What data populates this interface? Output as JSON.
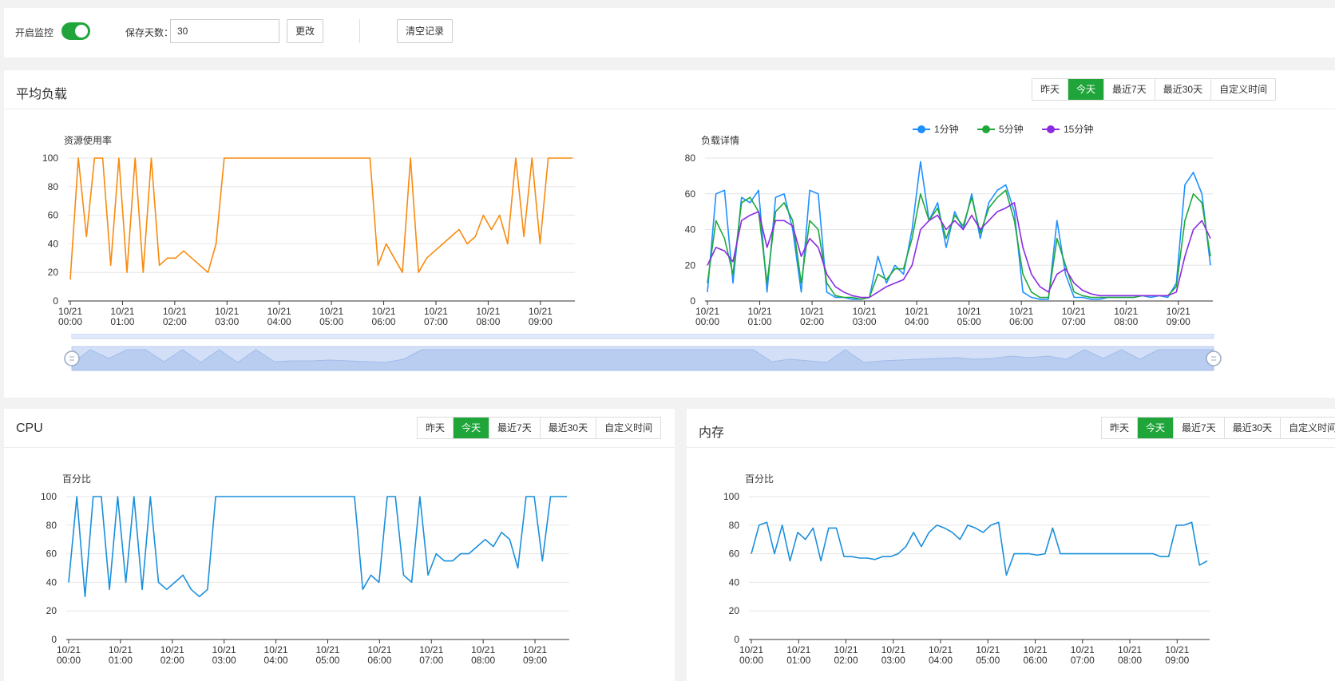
{
  "toolbar": {
    "monitor_label": "开启监控",
    "monitor_enabled": true,
    "days_label": "保存天数：",
    "days_value": "30",
    "change_button": "更改",
    "clear_button": "清空记录"
  },
  "range_options": [
    "昨天",
    "今天",
    "最近7天",
    "最近30天",
    "自定义时间"
  ],
  "active_range": "今天",
  "colors": {
    "accent": "#20a53a",
    "orange": "#f98a0e",
    "blue": "#1e90ff",
    "green": "#1fa83a",
    "purple": "#8b2be2",
    "cpu_blue": "#1a8fdc"
  },
  "x_ticks": [
    "10/21\n00:00",
    "10/21\n01:00",
    "10/21\n02:00",
    "10/21\n03:00",
    "10/21\n04:00",
    "10/21\n05:00",
    "10/21\n06:00",
    "10/21\n07:00",
    "10/21\n08:00",
    "10/21\n09:00"
  ],
  "load_panel": {
    "title": "平均负载"
  },
  "cpu_panel": {
    "title": "CPU"
  },
  "mem_panel": {
    "title": "内存"
  },
  "chart_data": [
    {
      "type": "line",
      "ylabel": "资源使用率",
      "ylim": [
        0,
        100
      ],
      "yticks": [
        0,
        20,
        40,
        60,
        80,
        100
      ],
      "x": [
        "00:00",
        "00:15",
        "00:30",
        "00:45",
        "01:00",
        "01:15",
        "01:30",
        "01:45",
        "02:00",
        "02:15",
        "02:30",
        "02:45",
        "03:00",
        "03:15",
        "03:30",
        "03:45",
        "04:00",
        "04:15",
        "04:30",
        "04:45",
        "05:00",
        "05:15",
        "05:30",
        "05:45",
        "06:00",
        "06:15",
        "06:30",
        "06:45",
        "07:00",
        "07:15",
        "07:30",
        "07:45",
        "08:00",
        "08:15",
        "08:30",
        "08:45",
        "09:00",
        "09:15",
        "09:20"
      ],
      "series": [
        {
          "color": "orange",
          "values": [
            15,
            100,
            45,
            100,
            100,
            25,
            100,
            20,
            100,
            20,
            100,
            25,
            30,
            30,
            35,
            30,
            25,
            20,
            40,
            100,
            100,
            100,
            100,
            100,
            100,
            100,
            100,
            100,
            100,
            100,
            100,
            100,
            100,
            100,
            100,
            100,
            100,
            100,
            25,
            40,
            30,
            20,
            100,
            20,
            30,
            35,
            40,
            45,
            50,
            40,
            45,
            60,
            50,
            60,
            40,
            100,
            45,
            100,
            40,
            100,
            100,
            100,
            100
          ]
        }
      ]
    },
    {
      "type": "line",
      "ylabel": "负载详情",
      "ylim": [
        0,
        80
      ],
      "yticks": [
        0,
        20,
        40,
        60,
        80
      ],
      "legend_position": "top",
      "series": [
        {
          "name": "1分钟",
          "color": "blue",
          "values": [
            5,
            60,
            62,
            10,
            58,
            55,
            62,
            5,
            58,
            60,
            40,
            5,
            62,
            60,
            5,
            2,
            2,
            1,
            1,
            2,
            25,
            10,
            20,
            15,
            40,
            78,
            45,
            55,
            30,
            50,
            40,
            60,
            35,
            55,
            62,
            65,
            50,
            5,
            2,
            1,
            1,
            45,
            15,
            2,
            2,
            1,
            1,
            2,
            2,
            2,
            2,
            3,
            2,
            3,
            2,
            10,
            65,
            72,
            60,
            20
          ]
        },
        {
          "name": "5分钟",
          "color": "green",
          "values": [
            10,
            45,
            35,
            15,
            55,
            58,
            50,
            10,
            50,
            55,
            45,
            10,
            45,
            40,
            10,
            3,
            2,
            2,
            1,
            2,
            15,
            12,
            18,
            18,
            35,
            60,
            45,
            52,
            35,
            48,
            42,
            58,
            38,
            52,
            58,
            62,
            45,
            15,
            5,
            2,
            2,
            35,
            20,
            5,
            3,
            2,
            2,
            2,
            2,
            2,
            2,
            3,
            3,
            3,
            3,
            8,
            45,
            60,
            55,
            25
          ]
        },
        {
          "name": "15分钟",
          "color": "purple",
          "values": [
            20,
            30,
            28,
            22,
            45,
            48,
            50,
            30,
            45,
            45,
            42,
            25,
            35,
            30,
            15,
            8,
            5,
            3,
            2,
            2,
            5,
            8,
            10,
            12,
            20,
            40,
            45,
            48,
            40,
            45,
            40,
            48,
            40,
            45,
            50,
            52,
            55,
            30,
            15,
            8,
            5,
            15,
            18,
            10,
            6,
            4,
            3,
            3,
            3,
            3,
            3,
            3,
            3,
            3,
            3,
            5,
            25,
            40,
            45,
            35
          ]
        }
      ]
    },
    {
      "type": "line",
      "ylabel": "百分比",
      "ylim": [
        0,
        100
      ],
      "yticks": [
        0,
        20,
        40,
        60,
        80,
        100
      ],
      "series": [
        {
          "color": "cpu_blue",
          "values": [
            40,
            100,
            30,
            100,
            100,
            35,
            100,
            40,
            100,
            35,
            100,
            40,
            35,
            40,
            45,
            35,
            30,
            35,
            100,
            100,
            100,
            100,
            100,
            100,
            100,
            100,
            100,
            100,
            100,
            100,
            100,
            100,
            100,
            100,
            100,
            100,
            35,
            45,
            40,
            100,
            100,
            45,
            40,
            100,
            45,
            60,
            55,
            55,
            60,
            60,
            65,
            70,
            65,
            75,
            70,
            50,
            100,
            100,
            55,
            100,
            100,
            100
          ]
        }
      ]
    },
    {
      "type": "line",
      "ylabel": "百分比",
      "ylim": [
        0,
        100
      ],
      "yticks": [
        0,
        20,
        40,
        60,
        80,
        100
      ],
      "series": [
        {
          "color": "cpu_blue",
          "values": [
            60,
            80,
            82,
            60,
            80,
            55,
            75,
            70,
            78,
            55,
            78,
            78,
            58,
            58,
            57,
            57,
            56,
            58,
            58,
            60,
            65,
            75,
            65,
            75,
            80,
            78,
            75,
            70,
            80,
            78,
            75,
            80,
            82,
            45,
            60,
            60,
            60,
            59,
            60,
            78,
            60,
            60,
            60,
            60,
            60,
            60,
            60,
            60,
            60,
            60,
            60,
            60,
            60,
            58,
            58,
            80,
            80,
            82,
            52,
            55
          ]
        }
      ]
    }
  ]
}
